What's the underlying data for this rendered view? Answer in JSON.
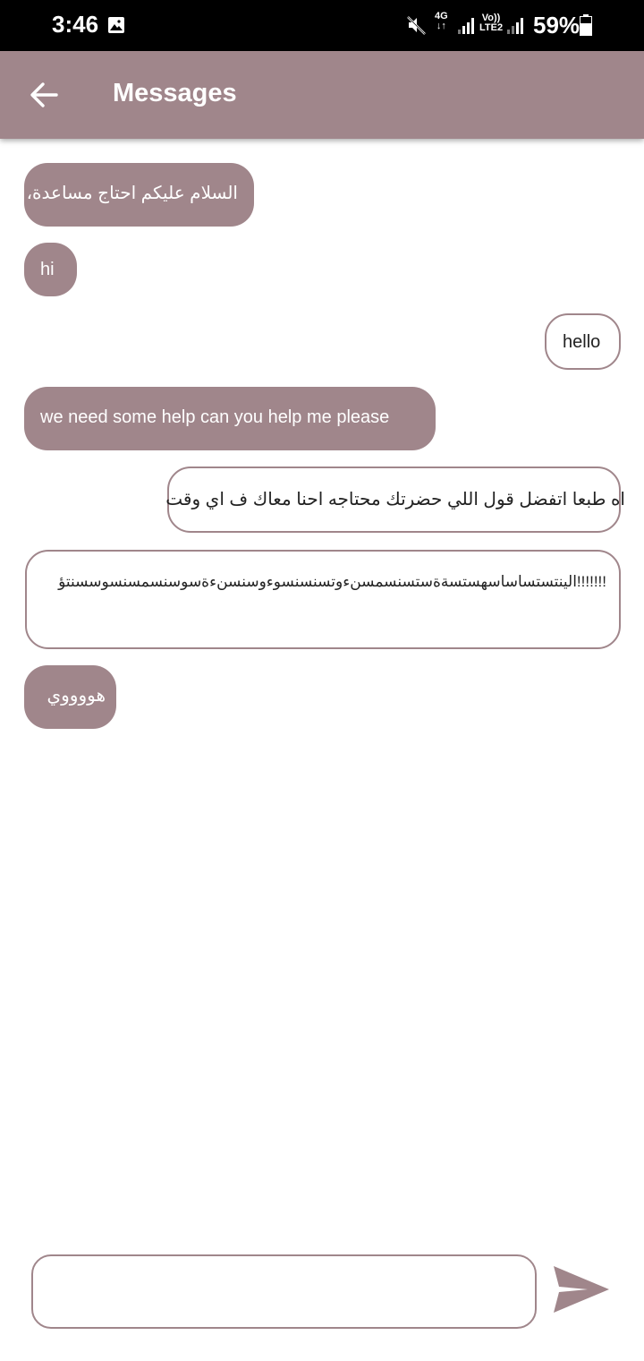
{
  "status_bar": {
    "time": "3:46",
    "network_type": "4G",
    "volte_label_top": "Vo))",
    "volte_label_bottom": "LTE2",
    "battery": "59%"
  },
  "app_bar": {
    "title": "Messages"
  },
  "messages": [
    {
      "direction": "incoming",
      "text": "السلام عليكم احتاج مساعدة،"
    },
    {
      "direction": "incoming",
      "text": "hi"
    },
    {
      "direction": "outgoing",
      "text": "hello"
    },
    {
      "direction": "incoming",
      "text": "we need some help can you help me please"
    },
    {
      "direction": "outgoing",
      "text": "اه طبعا اتفضل قول اللي حضرتك محتاجه احنا معاك ف اي وقت"
    },
    {
      "direction": "outgoing",
      "text": "!!!!!!!الينتستساساسهستسةةستسنسمسنءوتسنسنسوءوسنسنءةسوسنسمسنسوسسنتؤ"
    },
    {
      "direction": "incoming",
      "text": "هووووي"
    }
  ],
  "composer": {
    "placeholder": "",
    "value": ""
  },
  "colors": {
    "accent": "#a0868b",
    "status_bar": "#000000",
    "background": "#ffffff"
  },
  "icons": {
    "back": "arrow-left-icon",
    "send": "send-icon",
    "gallery": "image-icon",
    "mute": "mute-icon",
    "signal": "signal-icon",
    "battery": "battery-icon"
  }
}
